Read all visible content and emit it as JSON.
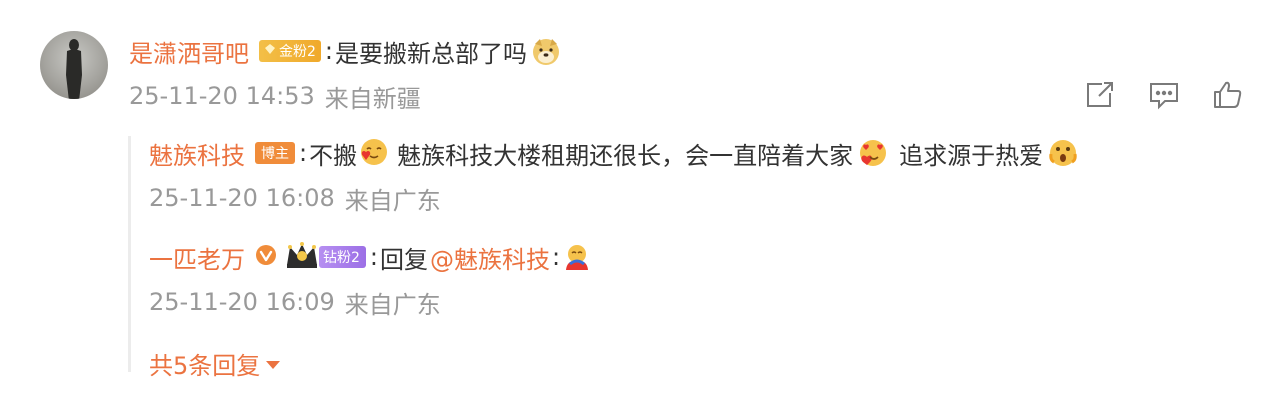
{
  "comment": {
    "username": "是潇洒哥吧",
    "fan_badge": "金粉2",
    "text": "是要搬新总部了吗",
    "timestamp": "25-11-20 14:53",
    "location": "来自新疆",
    "actions": {
      "share_icon": "share-icon",
      "comment_icon": "comment-icon",
      "like_icon": "like-icon"
    }
  },
  "replies": [
    {
      "username": "魅族科技",
      "badge": "博主",
      "text_part1": "不搬",
      "text_part2": "魅族科技大楼租期还很长，会一直陪着大家",
      "text_part3": "追求源于热爱",
      "timestamp": "25-11-20 16:08",
      "location": "来自广东"
    },
    {
      "username": "一匹老万",
      "badge": "钻粉2",
      "reply_prefix": "回复",
      "mention": "@魅族科技",
      "timestamp": "25-11-20 16:09",
      "location": "来自广东"
    }
  ],
  "more_replies": "共5条回复",
  "colors": {
    "username": "#eb7340",
    "text": "#333333",
    "meta": "#999999",
    "thread_line": "#ececec"
  }
}
